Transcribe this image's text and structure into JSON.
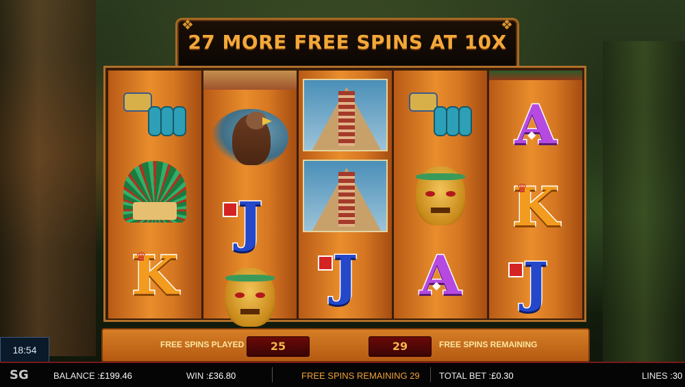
{
  "banner": {
    "text": "27 MORE FREE SPINS AT 10X"
  },
  "reels": [
    [
      "serpent",
      "headdress",
      "K"
    ],
    [
      "pyramid-partial",
      "eagle",
      "J",
      "mask"
    ],
    [
      "pyramid",
      "pyramid",
      "J"
    ],
    [
      "serpent",
      "mask",
      "A"
    ],
    [
      "partial",
      "A",
      "K",
      "J"
    ]
  ],
  "counters": {
    "played_label": "FREE SPINS PLAYED",
    "played_value": "25",
    "remaining_value": "29",
    "remaining_label": "FREE SPINS REMAINING"
  },
  "status": {
    "clock": "18:54",
    "brand": "SG",
    "balance_label": "BALANCE :",
    "balance_value": "£199.46",
    "win_label": "WIN :",
    "win_value": "£36.80",
    "free_spins_text": "FREE SPINS REMAINING 29",
    "total_bet_label": "TOTAL BET :",
    "total_bet_value": "£0.30",
    "lines_label": "LINES :",
    "lines_value": "30"
  },
  "letters": {
    "A": "A",
    "K": "K",
    "J": "J"
  },
  "icons": {
    "crown": "♛",
    "gem": "◆",
    "ornament": "❖"
  },
  "colors": {
    "accent": "#f2a83a",
    "reel": "#e98d2c",
    "frame": "#b0702a"
  }
}
